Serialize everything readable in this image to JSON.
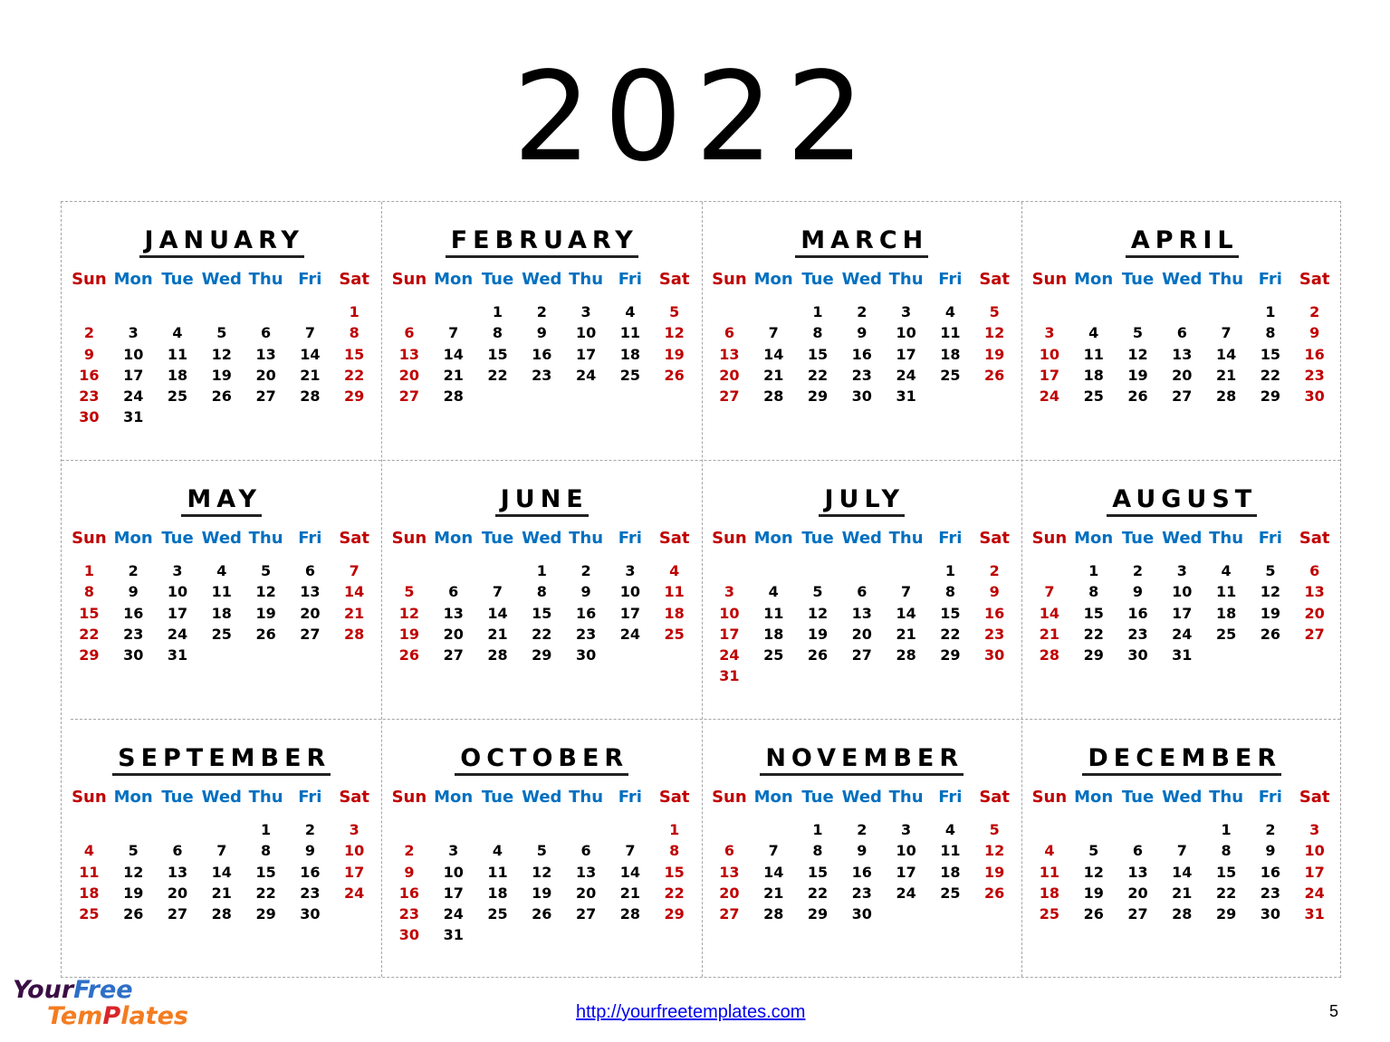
{
  "year": "2022",
  "weekday_labels": [
    "Sun",
    "Mon",
    "Tue",
    "Wed",
    "Thu",
    "Fri",
    "Sat"
  ],
  "colors": {
    "weekend": "#c00000",
    "weekday_header": "#0070c0",
    "date": "#000000"
  },
  "months": [
    {
      "name": "JANUARY",
      "weeks": [
        [
          "",
          "",
          "",
          "",
          "",
          "",
          "1"
        ],
        [
          "2",
          "3",
          "4",
          "5",
          "6",
          "7",
          "8"
        ],
        [
          "9",
          "10",
          "11",
          "12",
          "13",
          "14",
          "15"
        ],
        [
          "16",
          "17",
          "18",
          "19",
          "20",
          "21",
          "22"
        ],
        [
          "23",
          "24",
          "25",
          "26",
          "27",
          "28",
          "29"
        ],
        [
          "30",
          "31",
          "",
          "",
          "",
          "",
          ""
        ]
      ]
    },
    {
      "name": "FEBRUARY",
      "weeks": [
        [
          "",
          "",
          "1",
          "2",
          "3",
          "4",
          "5"
        ],
        [
          "6",
          "7",
          "8",
          "9",
          "10",
          "11",
          "12"
        ],
        [
          "13",
          "14",
          "15",
          "16",
          "17",
          "18",
          "19"
        ],
        [
          "20",
          "21",
          "22",
          "23",
          "24",
          "25",
          "26"
        ],
        [
          "27",
          "28",
          "",
          "",
          "",
          "",
          ""
        ]
      ]
    },
    {
      "name": "MARCH",
      "weeks": [
        [
          "",
          "",
          "1",
          "2",
          "3",
          "4",
          "5"
        ],
        [
          "6",
          "7",
          "8",
          "9",
          "10",
          "11",
          "12"
        ],
        [
          "13",
          "14",
          "15",
          "16",
          "17",
          "18",
          "19"
        ],
        [
          "20",
          "21",
          "22",
          "23",
          "24",
          "25",
          "26"
        ],
        [
          "27",
          "28",
          "29",
          "30",
          "31",
          "",
          ""
        ]
      ]
    },
    {
      "name": "APRIL",
      "weeks": [
        [
          "",
          "",
          "",
          "",
          "",
          "1",
          "2"
        ],
        [
          "3",
          "4",
          "5",
          "6",
          "7",
          "8",
          "9"
        ],
        [
          "10",
          "11",
          "12",
          "13",
          "14",
          "15",
          "16"
        ],
        [
          "17",
          "18",
          "19",
          "20",
          "21",
          "22",
          "23"
        ],
        [
          "24",
          "25",
          "26",
          "27",
          "28",
          "29",
          "30"
        ]
      ]
    },
    {
      "name": "MAY",
      "weeks": [
        [
          "1",
          "2",
          "3",
          "4",
          "5",
          "6",
          "7"
        ],
        [
          "8",
          "9",
          "10",
          "11",
          "12",
          "13",
          "14"
        ],
        [
          "15",
          "16",
          "17",
          "18",
          "19",
          "20",
          "21"
        ],
        [
          "22",
          "23",
          "24",
          "25",
          "26",
          "27",
          "28"
        ],
        [
          "29",
          "30",
          "31",
          "",
          "",
          "",
          ""
        ]
      ]
    },
    {
      "name": "JUNE",
      "weeks": [
        [
          "",
          "",
          "",
          "1",
          "2",
          "3",
          "4"
        ],
        [
          "5",
          "6",
          "7",
          "8",
          "9",
          "10",
          "11"
        ],
        [
          "12",
          "13",
          "14",
          "15",
          "16",
          "17",
          "18"
        ],
        [
          "19",
          "20",
          "21",
          "22",
          "23",
          "24",
          "25"
        ],
        [
          "26",
          "27",
          "28",
          "29",
          "30",
          "",
          ""
        ]
      ]
    },
    {
      "name": "JULY",
      "weeks": [
        [
          "",
          "",
          "",
          "",
          "",
          "1",
          "2"
        ],
        [
          "3",
          "4",
          "5",
          "6",
          "7",
          "8",
          "9"
        ],
        [
          "10",
          "11",
          "12",
          "13",
          "14",
          "15",
          "16"
        ],
        [
          "17",
          "18",
          "19",
          "20",
          "21",
          "22",
          "23"
        ],
        [
          "24",
          "25",
          "26",
          "27",
          "28",
          "29",
          "30"
        ],
        [
          "31",
          "",
          "",
          "",
          "",
          "",
          ""
        ]
      ]
    },
    {
      "name": "AUGUST",
      "weeks": [
        [
          "",
          "1",
          "2",
          "3",
          "4",
          "5",
          "6"
        ],
        [
          "7",
          "8",
          "9",
          "10",
          "11",
          "12",
          "13"
        ],
        [
          "14",
          "15",
          "16",
          "17",
          "18",
          "19",
          "20"
        ],
        [
          "21",
          "22",
          "23",
          "24",
          "25",
          "26",
          "27"
        ],
        [
          "28",
          "29",
          "30",
          "31",
          "",
          "",
          ""
        ]
      ]
    },
    {
      "name": "SEPTEMBER",
      "weeks": [
        [
          "",
          "",
          "",
          "",
          "1",
          "2",
          "3"
        ],
        [
          "4",
          "5",
          "6",
          "7",
          "8",
          "9",
          "10"
        ],
        [
          "11",
          "12",
          "13",
          "14",
          "15",
          "16",
          "17"
        ],
        [
          "18",
          "19",
          "20",
          "21",
          "22",
          "23",
          "24"
        ],
        [
          "25",
          "26",
          "27",
          "28",
          "29",
          "30",
          ""
        ]
      ]
    },
    {
      "name": "OCTOBER",
      "weeks": [
        [
          "",
          "",
          "",
          "",
          "",
          "",
          "1"
        ],
        [
          "2",
          "3",
          "4",
          "5",
          "6",
          "7",
          "8"
        ],
        [
          "9",
          "10",
          "11",
          "12",
          "13",
          "14",
          "15"
        ],
        [
          "16",
          "17",
          "18",
          "19",
          "20",
          "21",
          "22"
        ],
        [
          "23",
          "24",
          "25",
          "26",
          "27",
          "28",
          "29"
        ],
        [
          "30",
          "31",
          "",
          "",
          "",
          "",
          ""
        ]
      ]
    },
    {
      "name": "NOVEMBER",
      "weeks": [
        [
          "",
          "",
          "1",
          "2",
          "3",
          "4",
          "5"
        ],
        [
          "6",
          "7",
          "8",
          "9",
          "10",
          "11",
          "12"
        ],
        [
          "13",
          "14",
          "15",
          "16",
          "17",
          "18",
          "19"
        ],
        [
          "20",
          "21",
          "22",
          "23",
          "24",
          "25",
          "26"
        ],
        [
          "27",
          "28",
          "29",
          "30",
          "",
          "",
          ""
        ]
      ]
    },
    {
      "name": "DECEMBER",
      "weeks": [
        [
          "",
          "",
          "",
          "",
          "1",
          "2",
          "3"
        ],
        [
          "4",
          "5",
          "6",
          "7",
          "8",
          "9",
          "10"
        ],
        [
          "11",
          "12",
          "13",
          "14",
          "15",
          "16",
          "17"
        ],
        [
          "18",
          "19",
          "20",
          "21",
          "22",
          "23",
          "24"
        ],
        [
          "25",
          "26",
          "27",
          "28",
          "29",
          "30",
          "31"
        ]
      ]
    }
  ],
  "footer": {
    "logo": {
      "word1": "Your",
      "word2": "Free",
      "word3_a": "Tem",
      "word3_p": "P",
      "word3_b": "lates",
      "icon": "yourfreetemplates-logo"
    },
    "url": "http://yourfreetemplates.com",
    "page_number": "5"
  }
}
